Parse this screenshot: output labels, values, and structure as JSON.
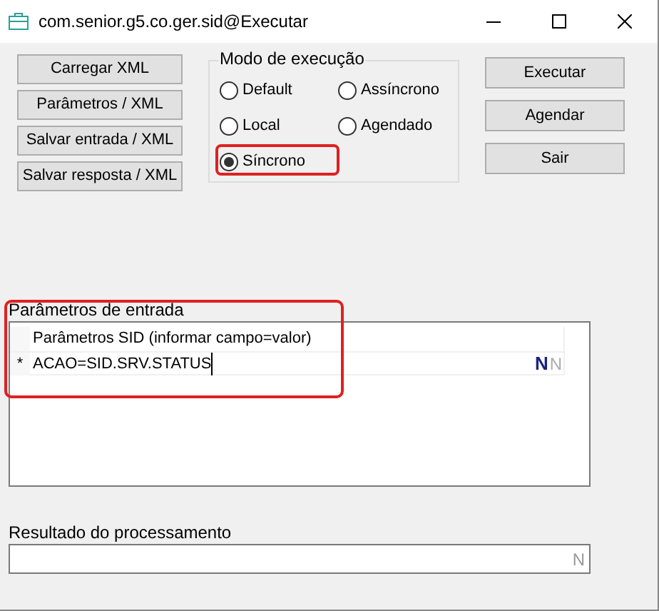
{
  "window": {
    "title": "com.senior.g5.co.ger.sid@Executar"
  },
  "left_buttons": [
    "Carregar XML",
    "Parâmetros / XML",
    "Salvar entrada / XML",
    "Salvar resposta / XML"
  ],
  "execution_mode": {
    "title": "Modo de execução",
    "options": [
      {
        "label": "Default",
        "selected": false
      },
      {
        "label": "Assíncrono",
        "selected": false
      },
      {
        "label": "Local",
        "selected": false
      },
      {
        "label": "Agendado",
        "selected": false
      },
      {
        "label": "Síncrono",
        "selected": true
      }
    ]
  },
  "right_buttons": [
    "Executar",
    "Agendar",
    "Sair"
  ],
  "input_parameters": {
    "label": "Parâmetros de entrada",
    "column_header": "Parâmetros SID (informar campo=valor)",
    "row_marker": "*",
    "value": "ACAO=SID.SRV.STATUS",
    "indicator": "N",
    "indicator_2": "N"
  },
  "result": {
    "label": "Resultado do processamento",
    "indicator": "N"
  }
}
